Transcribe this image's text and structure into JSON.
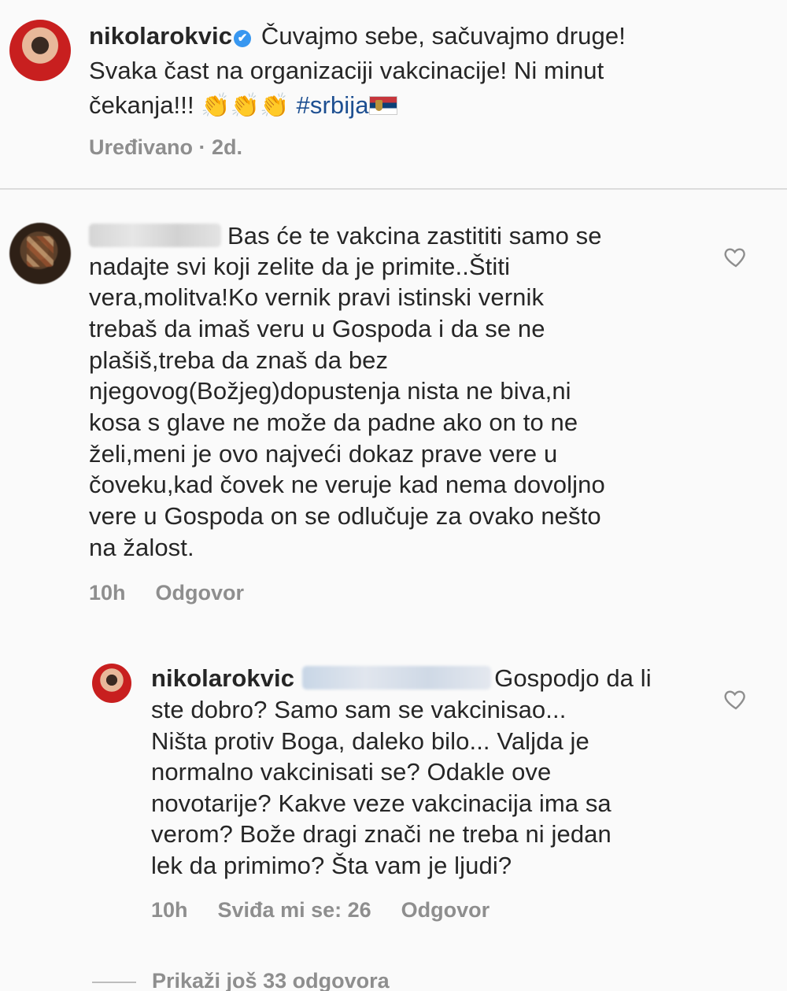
{
  "post": {
    "username": "nikolarokvic",
    "verified_symbol": "✔",
    "caption_line1": "Čuvajmo sebe, sačuvajmo druge!",
    "caption_line2": "Svaka čast na organizaciji vakcinacije! Ni minut",
    "caption_line3_text": "čekanja!!!",
    "emoji": "👏",
    "hashtag": "#srbija",
    "meta": "Uređivano · 2d."
  },
  "comment": {
    "lines": [
      "Bas će te vakcina zastititi samo se",
      "nadajte svi koji zelite da je primite..Štiti",
      "vera,molitva!Ko vernik pravi istinski vernik",
      "trebaš da imaš veru u Gospoda i da se ne",
      "plašiš,treba da znaš da bez",
      "njegovog(Božjeg)dopustenja nista ne biva,ni",
      "kosa s glave ne može da padne ako on to ne",
      "želi,meni je ovo najveći dokaz prave vere u",
      "čoveku,kad čovek ne veruje kad nema dovoljno",
      "vere u Gospoda on se odlučuje za ovako nešto",
      "na žalost."
    ],
    "time": "10h",
    "reply_label": "Odgovor"
  },
  "reply": {
    "username": "nikolarokvic",
    "lines": [
      "Gospodjo da li",
      "ste dobro? Samo sam se vakcinisao...",
      "Ništa protiv Boga, daleko bilo... Valjda je",
      "normalno vakcinisati se? Odakle ove",
      "novotarije? Kakve veze vakcinacija ima sa",
      "verom? Bože dragi znači ne treba ni jedan",
      "lek da primimo? Šta vam je ljudi?"
    ],
    "time": "10h",
    "likes": "Sviđa mi se: 26",
    "reply_label": "Odgovor"
  },
  "show_more": "Prikaži još 33 odgovora",
  "colors": {
    "text": "#262626",
    "muted": "#8e8e8e",
    "hashtag": "#1d4f91",
    "verified": "#3897f0",
    "background": "#fafafa"
  }
}
